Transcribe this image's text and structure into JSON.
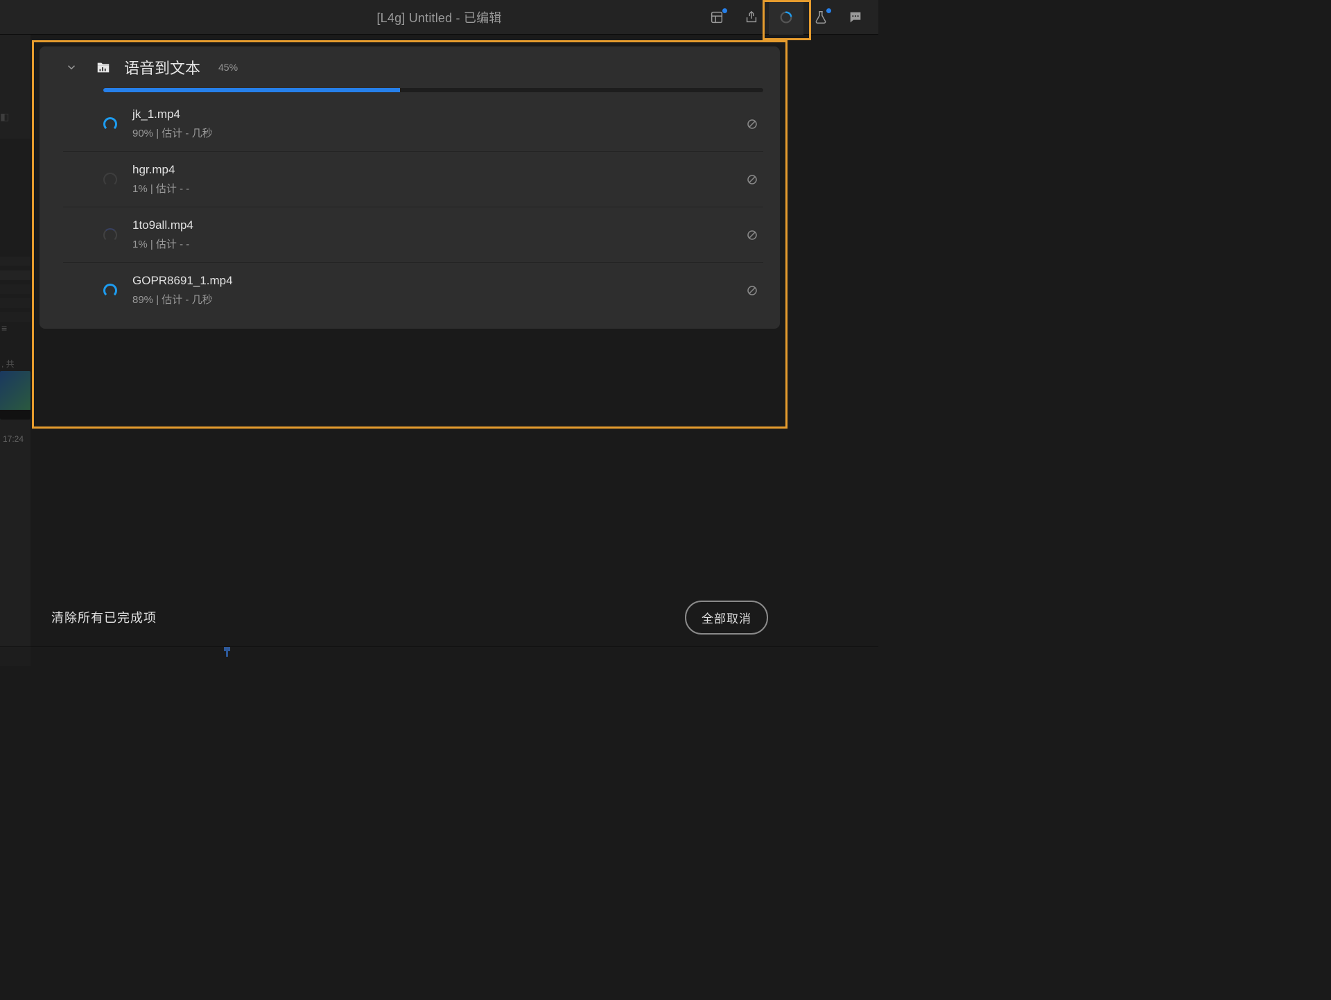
{
  "title": "[L4g] Untitled - 已编辑",
  "topbar_icons": {
    "workspace": "workspace-icon",
    "share": "share-icon",
    "progress": "progress-ring-icon",
    "beaker": "beaker-icon",
    "chat": "chat-icon"
  },
  "popover": {
    "task_title": "语音到文本",
    "task_percent_label": "45%",
    "task_percent_value": 45,
    "items": [
      {
        "name": "jk_1.mp4",
        "sub": "90% | 估计 - 几秒",
        "state": "active"
      },
      {
        "name": "hgr.mp4",
        "sub": "1% | 估计 - -",
        "state": "idle"
      },
      {
        "name": "1to9all.mp4",
        "sub": "1% | 估计 - -",
        "state": "idle2"
      },
      {
        "name": "GOPR8691_1.mp4",
        "sub": "89% | 估计 - 几秒",
        "state": "active"
      }
    ]
  },
  "footer": {
    "clear": "清除所有已完成项",
    "cancel_all": "全部取消"
  },
  "left": {
    "ctx": ", 共",
    "tc": "17:24"
  }
}
